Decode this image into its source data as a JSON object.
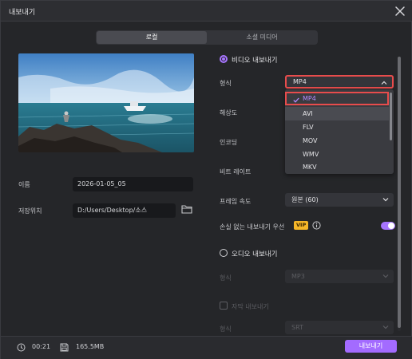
{
  "window": {
    "title": "내보내기"
  },
  "tabs": [
    {
      "label": "로컬"
    },
    {
      "label": "소셜 미디어"
    }
  ],
  "left": {
    "name_label": "이름",
    "name_value": "2026-01-05_05",
    "location_label": "저장위치",
    "location_value": "D:/Users/Desktop/소스"
  },
  "video": {
    "section_label": "비디오 내보내기",
    "format_label": "형식",
    "format_value": "MP4",
    "format_options": [
      "MP4",
      "AVI",
      "FLV",
      "MOV",
      "WMV",
      "MKV"
    ],
    "selected_option_index": 0,
    "resolution_label": "해상도",
    "encoding_label": "인코딩",
    "bitrate_label": "비트 레이트",
    "framerate_label": "프레임 속도",
    "framerate_value": "원본 (60)",
    "lossless_label": "손실 없는 내보내기 우선",
    "vip_badge": "VIP",
    "lossless_enabled": true
  },
  "audio": {
    "section_label": "오디오 내보내기",
    "format_label": "형식",
    "format_value": "MP3"
  },
  "subtitle": {
    "checkbox_label": "자막 내보내기",
    "format_label": "형식",
    "format_value": "SRT"
  },
  "footer": {
    "duration": "00:21",
    "size": "165.5MB",
    "export_button": "내보내기"
  },
  "colors": {
    "accent": "#a775ff",
    "focus_outline": "#e84c4c",
    "vip": "#f5b628"
  }
}
